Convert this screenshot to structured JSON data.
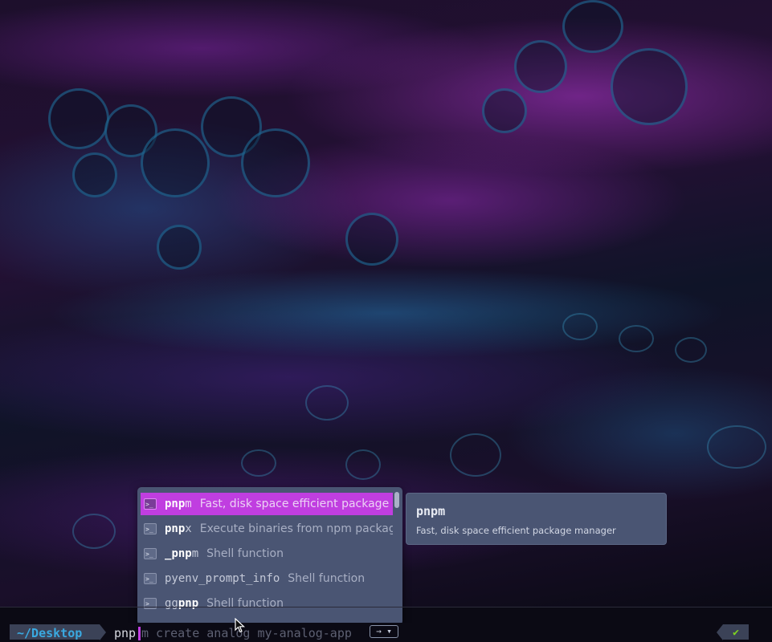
{
  "completion_menu": {
    "items": [
      {
        "match": "pnp",
        "rest": "m",
        "description": "Fast, disk space efficient package m",
        "selected": true
      },
      {
        "match": "pnp",
        "rest": "x",
        "description": "Execute binaries from npm package",
        "selected": false
      },
      {
        "pre": "_",
        "match": "pnp",
        "rest": "m",
        "description": "Shell function",
        "selected": false
      },
      {
        "word_html": "pyenv_prompt_info",
        "description": "Shell function",
        "selected": false
      },
      {
        "pre": "gg",
        "match": "pnp",
        "rest": "",
        "description": "Shell function",
        "selected": false
      }
    ],
    "kind_icon_text": ">_"
  },
  "doc_popup": {
    "title": "pnpm",
    "description": "Fast, disk space efficient package manager"
  },
  "prompt": {
    "directory": "~/Desktop",
    "typed": "pnp",
    "ghost_text": "m create analog my-analog-app",
    "accept_hint": "→ ▾",
    "status_icon": "✔"
  },
  "colors": {
    "selection": "#c03ee0",
    "menu_bg": "#4a5573",
    "directory": "#3aa9e0",
    "status_ok": "#7ed321"
  }
}
